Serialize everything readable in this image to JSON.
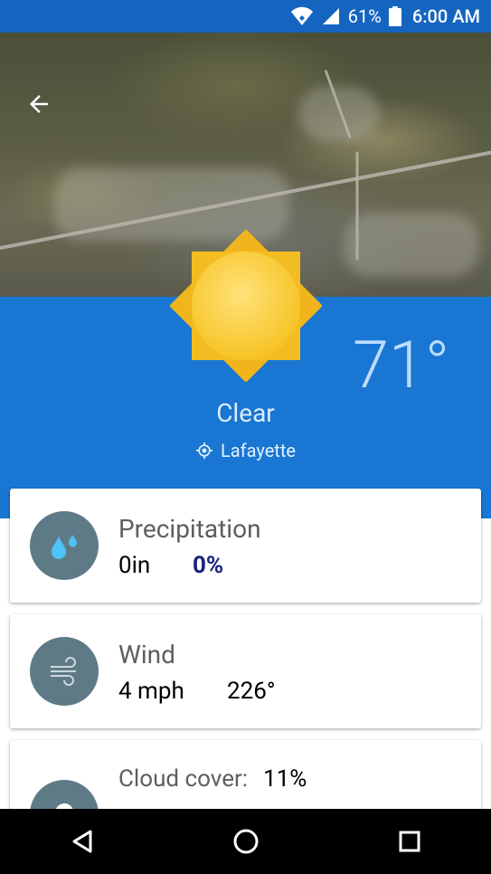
{
  "status_bar": {
    "battery_percent": "61%",
    "time": "6:00 AM",
    "icons": [
      "wifi-icon",
      "signal-icon",
      "battery-icon"
    ]
  },
  "header": {
    "back_icon": "arrow-left-icon",
    "weather_icon": "sun-icon",
    "temperature": "71°",
    "condition": "Clear",
    "location_icon": "location-icon",
    "location": "Lafayette"
  },
  "cards": {
    "precipitation": {
      "icon": "raindrops-icon",
      "title": "Precipitation",
      "amount": "0in",
      "chance": "0%"
    },
    "wind": {
      "icon": "wind-icon",
      "title": "Wind",
      "speed": "4 mph",
      "direction": "226°"
    },
    "cloud": {
      "icon": "cloud-icon",
      "title": "Cloud cover:",
      "value": "11%"
    }
  },
  "nav": {
    "back": "nav-back-icon",
    "home": "nav-home-icon",
    "recents": "nav-recents-icon"
  },
  "colors": {
    "status_bar": "#1565c0",
    "header_blue": "#1976d2",
    "icon_circle": "#5f7a87",
    "chance_text": "#1a237e"
  }
}
